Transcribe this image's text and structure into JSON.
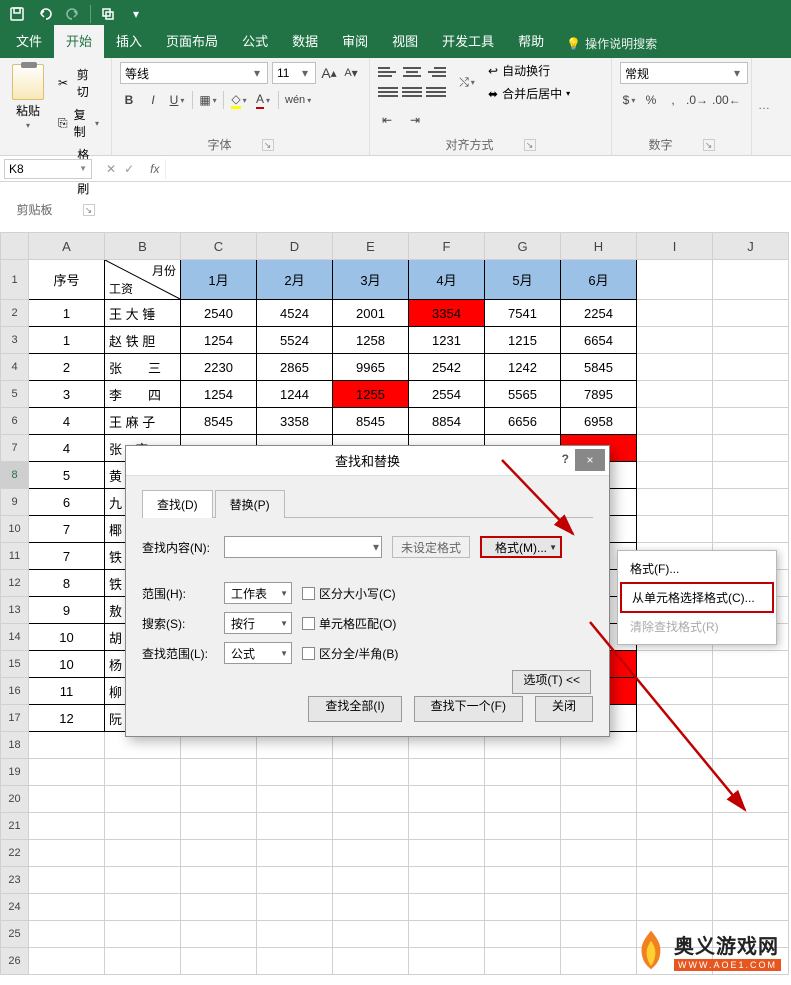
{
  "titlebar": {
    "save": "save",
    "undo": "undo",
    "redo": "redo",
    "t4": "t4"
  },
  "tabs": {
    "file": "文件",
    "home": "开始",
    "insert": "插入",
    "layout": "页面布局",
    "formula": "公式",
    "data": "数据",
    "review": "审阅",
    "view": "视图",
    "dev": "开发工具",
    "help": "帮助",
    "hint": "操作说明搜索"
  },
  "ribbon": {
    "clipboard": {
      "paste": "粘贴",
      "cut": "剪切",
      "copy": "复制",
      "brush": "格式刷",
      "label": "剪贴板"
    },
    "font": {
      "name": "等线",
      "size": "11",
      "grow": "A",
      "shrink": "A",
      "label": "字体",
      "b": "B",
      "i": "I",
      "u": "U",
      "wen": "wén"
    },
    "align": {
      "wrap": "自动换行",
      "merge": "合并后居中",
      "label": "对齐方式"
    },
    "number": {
      "general": "常规",
      "label": "数字"
    }
  },
  "namebox": "K8",
  "cols": [
    "A",
    "B",
    "C",
    "D",
    "E",
    "F",
    "G",
    "H",
    "I",
    "J"
  ],
  "rows": [
    "1",
    "2",
    "3",
    "4",
    "5",
    "6",
    "7",
    "8",
    "9",
    "10",
    "11",
    "12",
    "13",
    "14",
    "15",
    "16",
    "17",
    "18",
    "19",
    "20",
    "21",
    "22",
    "23",
    "24",
    "25",
    "26"
  ],
  "header": {
    "seq": "序号",
    "diag1": "月份",
    "diag2": "工资",
    "m": [
      "1月",
      "2月",
      "3月",
      "4月",
      "5月",
      "6月"
    ]
  },
  "rowsData": [
    {
      "seq": "1",
      "name": "王 大 锤",
      "v": [
        "2540",
        "4524",
        "2001",
        "3354",
        "7541",
        "2254"
      ],
      "red": [
        3
      ]
    },
    {
      "seq": "1",
      "name": "赵 铁 胆",
      "v": [
        "1254",
        "5524",
        "1258",
        "1231",
        "1215",
        "6654"
      ],
      "red": []
    },
    {
      "seq": "2",
      "name": "张　　三",
      "v": [
        "2230",
        "2865",
        "9965",
        "2542",
        "1242",
        "5845"
      ],
      "red": []
    },
    {
      "seq": "3",
      "name": "李　　四",
      "v": [
        "1254",
        "1244",
        "1255",
        "2554",
        "5565",
        "7895"
      ],
      "red": [
        2
      ]
    },
    {
      "seq": "4",
      "name": "王 麻 子",
      "v": [
        "8545",
        "3358",
        "8545",
        "8854",
        "6656",
        "6958"
      ],
      "red": []
    },
    {
      "seq": "4",
      "name": "张　麻",
      "v": [
        "",
        "",
        "",
        "",
        "",
        ""
      ],
      "red": [
        5
      ]
    },
    {
      "seq": "5",
      "name": "黄　四",
      "v": [
        "",
        "",
        "",
        "",
        "",
        ""
      ],
      "red": []
    },
    {
      "seq": "6",
      "name": "九",
      "v": [
        "",
        "",
        "",
        "",
        "",
        ""
      ],
      "red": []
    },
    {
      "seq": "7",
      "name": "椰",
      "v": [
        "",
        "",
        "",
        "",
        "",
        ""
      ],
      "red": []
    },
    {
      "seq": "7",
      "name": "铁",
      "v": [
        "",
        "",
        "",
        "",
        "",
        ""
      ],
      "red": []
    },
    {
      "seq": "8",
      "name": "铁",
      "v": [
        "",
        "",
        "",
        "",
        "",
        ""
      ],
      "red": []
    },
    {
      "seq": "9",
      "name": "敖",
      "v": [
        "",
        "",
        "",
        "",
        "",
        ""
      ],
      "red": []
    },
    {
      "seq": "10",
      "name": "胡　四",
      "v": [
        "",
        "",
        "",
        "",
        "",
        ""
      ],
      "red": []
    },
    {
      "seq": "10",
      "name": "杨　万",
      "v": [
        "",
        "",
        "",
        "",
        "",
        ""
      ],
      "red": [
        5
      ]
    },
    {
      "seq": "11",
      "name": "柳",
      "v": [
        "",
        "",
        "",
        "",
        "",
        ""
      ],
      "red": [
        5
      ]
    },
    {
      "seq": "12",
      "name": "阮",
      "v": [
        "",
        "",
        "",
        "",
        "",
        ""
      ],
      "red": []
    }
  ],
  "dialog": {
    "title": "查找和替换",
    "help": "?",
    "close": "×",
    "tabFind": "查找(D)",
    "tabReplace": "替换(P)",
    "findLabel": "查找内容(N):",
    "noFormat": "未设定格式",
    "formatBtn": "格式(M)...",
    "range": "范围(H):",
    "rangeVal": "工作表",
    "search": "搜索(S):",
    "searchVal": "按行",
    "lookin": "查找范围(L):",
    "lookinVal": "公式",
    "case": "区分大小写(C)",
    "whole": "单元格匹配(O)",
    "width": "区分全/半角(B)",
    "options": "选项(T) <<",
    "findAll": "查找全部(I)",
    "findNext": "查找下一个(F)",
    "closeBtn": "关闭"
  },
  "menu": {
    "m1": "格式(F)...",
    "m2": "从单元格选择格式(C)...",
    "m3": "清除查找格式(R)"
  },
  "watermark": {
    "cn": "奥义游戏网",
    "en": "WWW.AOE1.COM"
  }
}
